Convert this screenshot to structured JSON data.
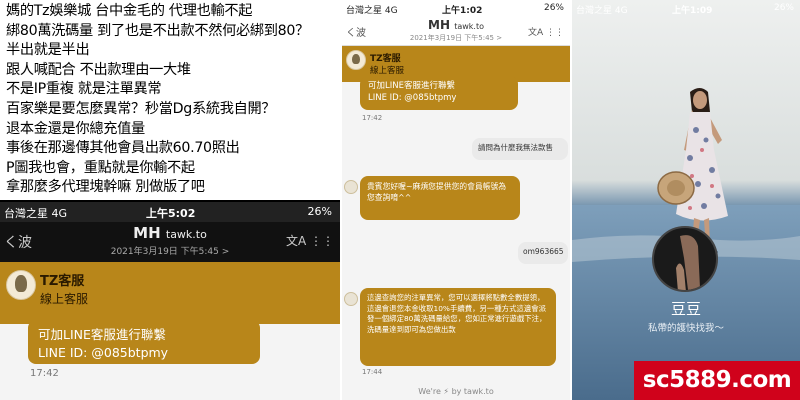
{
  "caption_lines": [
    "媽的Tz娛樂城 台中金毛的 代理也輸不起",
    "綁80萬洗碼量 到了也是不出款不然何必綁到80？",
    "半出就是半出",
    "跟人喊配合 不出款理由一大堆",
    "不是IP重複 就是注單異常",
    "百家樂是要怎麼異常？秒當Dg系統我自開？",
    "退本金還是你總充值量",
    "事後在那邊傳其他會員出款60.70照出",
    "P圖我也會，重點就是你輸不起",
    "拿那麼多代理塊幹嘛 別做版了吧"
  ],
  "p1": {
    "status": {
      "carrier": "台灣之星 4G",
      "time": "上午5:02",
      "battery": "26%"
    },
    "header": {
      "title": "MH",
      "site": "tawk.to",
      "date": "2021年3月19日 下午5:45 >",
      "back": "く波",
      "translate": "文A"
    },
    "agent": {
      "name": "TZ客服",
      "status": "線上客服"
    },
    "message": {
      "line1": "可加LINE客服進行聯繫",
      "line2": "LINE ID: @085btpmy",
      "time": "17:42"
    }
  },
  "p2": {
    "status": {
      "carrier": "台灣之星 4G",
      "time": "上午1:02",
      "battery": "26%"
    },
    "header": {
      "title": "MH",
      "site": "tawk.to",
      "date": "2021年3月19日 下午5:45 >",
      "back": "く波",
      "translate": "文A"
    },
    "agent": {
      "name": "TZ客服",
      "status": "線上客服"
    },
    "messages": [
      {
        "side": "left",
        "text": "可加LINE客服進行聯繫\nLINE ID: @085btpmy",
        "time": "17:42"
      },
      {
        "side": "right",
        "text": "請問為什麼我無法款售"
      },
      {
        "side": "left",
        "text": "貴賓您好喔~麻煩您提供您的會員帳號為您查詢唷^^"
      },
      {
        "side": "right",
        "text": "om963665"
      },
      {
        "side": "left",
        "text": "這邊查詢您的注單異常，您可以選擇將點數全數提領，這邊會退您本金收取10%手續費，另一種方式這邊會派發一個綁定80萬洗碼量給您，您如正常進行遊戲下注，洗碼量達到即可為您做出款",
        "time": "17:44"
      }
    ],
    "footer": "We're ⚡ by tawk.to"
  },
  "p3": {
    "status": {
      "carrier": "台灣之星 4G",
      "time": "上午1:09",
      "battery": "26%"
    },
    "profile": {
      "name": "豆豆",
      "tagline": "私帶的護快找我～"
    }
  },
  "watermark": "sc5889.com",
  "colors": {
    "gold": "#b8861a",
    "watermark": "#d0021b",
    "sea": "#5b7fa0"
  }
}
